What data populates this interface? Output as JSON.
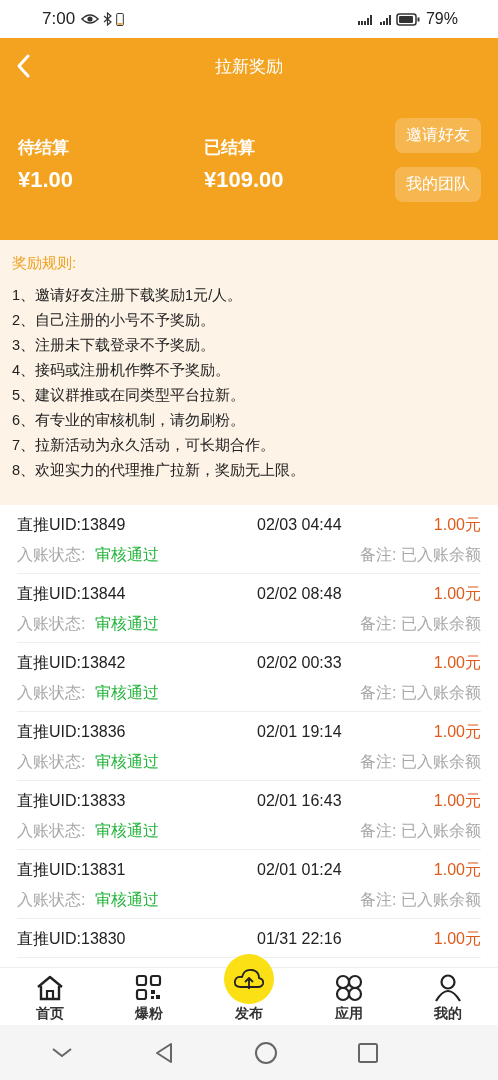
{
  "status_bar": {
    "time": "7:00",
    "battery": "79%"
  },
  "header": {
    "title": "拉新奖励"
  },
  "summary": {
    "items": [
      {
        "label": "待结算",
        "amount": "¥1.00"
      },
      {
        "label": "已结算",
        "amount": "¥109.00"
      }
    ],
    "buttons": [
      "邀请好友",
      "我的团队"
    ]
  },
  "rules": {
    "title": "奖励规则:",
    "lines": [
      "1、邀请好友注册下载奖励1元/人。",
      "2、自己注册的小号不予奖励。",
      "3、注册未下载登录不予奖励。",
      "4、接码或注册机作弊不予奖励。",
      "5、建议群推或在同类型平台拉新。",
      "6、有专业的审核机制，请勿刷粉。",
      "7、拉新活动为永久活动，可长期合作。",
      "8、欢迎实力的代理推广拉新，奖励无上限。"
    ]
  },
  "records": [
    {
      "uid": "直推UID:13849",
      "time": "02/03 04:44",
      "amount": "1.00元",
      "status_label": "入账状态:",
      "status": "审核通过",
      "note": "备注:  已入账余额"
    },
    {
      "uid": "直推UID:13844",
      "time": "02/02 08:48",
      "amount": "1.00元",
      "status_label": "入账状态:",
      "status": "审核通过",
      "note": "备注:  已入账余额"
    },
    {
      "uid": "直推UID:13842",
      "time": "02/02 00:33",
      "amount": "1.00元",
      "status_label": "入账状态:",
      "status": "审核通过",
      "note": "备注:  已入账余额"
    },
    {
      "uid": "直推UID:13836",
      "time": "02/01 19:14",
      "amount": "1.00元",
      "status_label": "入账状态:",
      "status": "审核通过",
      "note": "备注:  已入账余额"
    },
    {
      "uid": "直推UID:13833",
      "time": "02/01 16:43",
      "amount": "1.00元",
      "status_label": "入账状态:",
      "status": "审核通过",
      "note": "备注:  已入账余额"
    },
    {
      "uid": "直推UID:13831",
      "time": "02/01 01:24",
      "amount": "1.00元",
      "status_label": "入账状态:",
      "status": "审核通过",
      "note": "备注:  已入账余额"
    },
    {
      "uid": "直推UID:13830",
      "time": "01/31 22:16",
      "amount": "1.00元"
    }
  ],
  "tab_bar": [
    {
      "label": "首页",
      "kind": "home"
    },
    {
      "label": "爆粉",
      "kind": "qr"
    },
    {
      "label": "发布",
      "kind": "upload"
    },
    {
      "label": "应用",
      "kind": "apps"
    },
    {
      "label": "我的",
      "kind": "user"
    }
  ]
}
